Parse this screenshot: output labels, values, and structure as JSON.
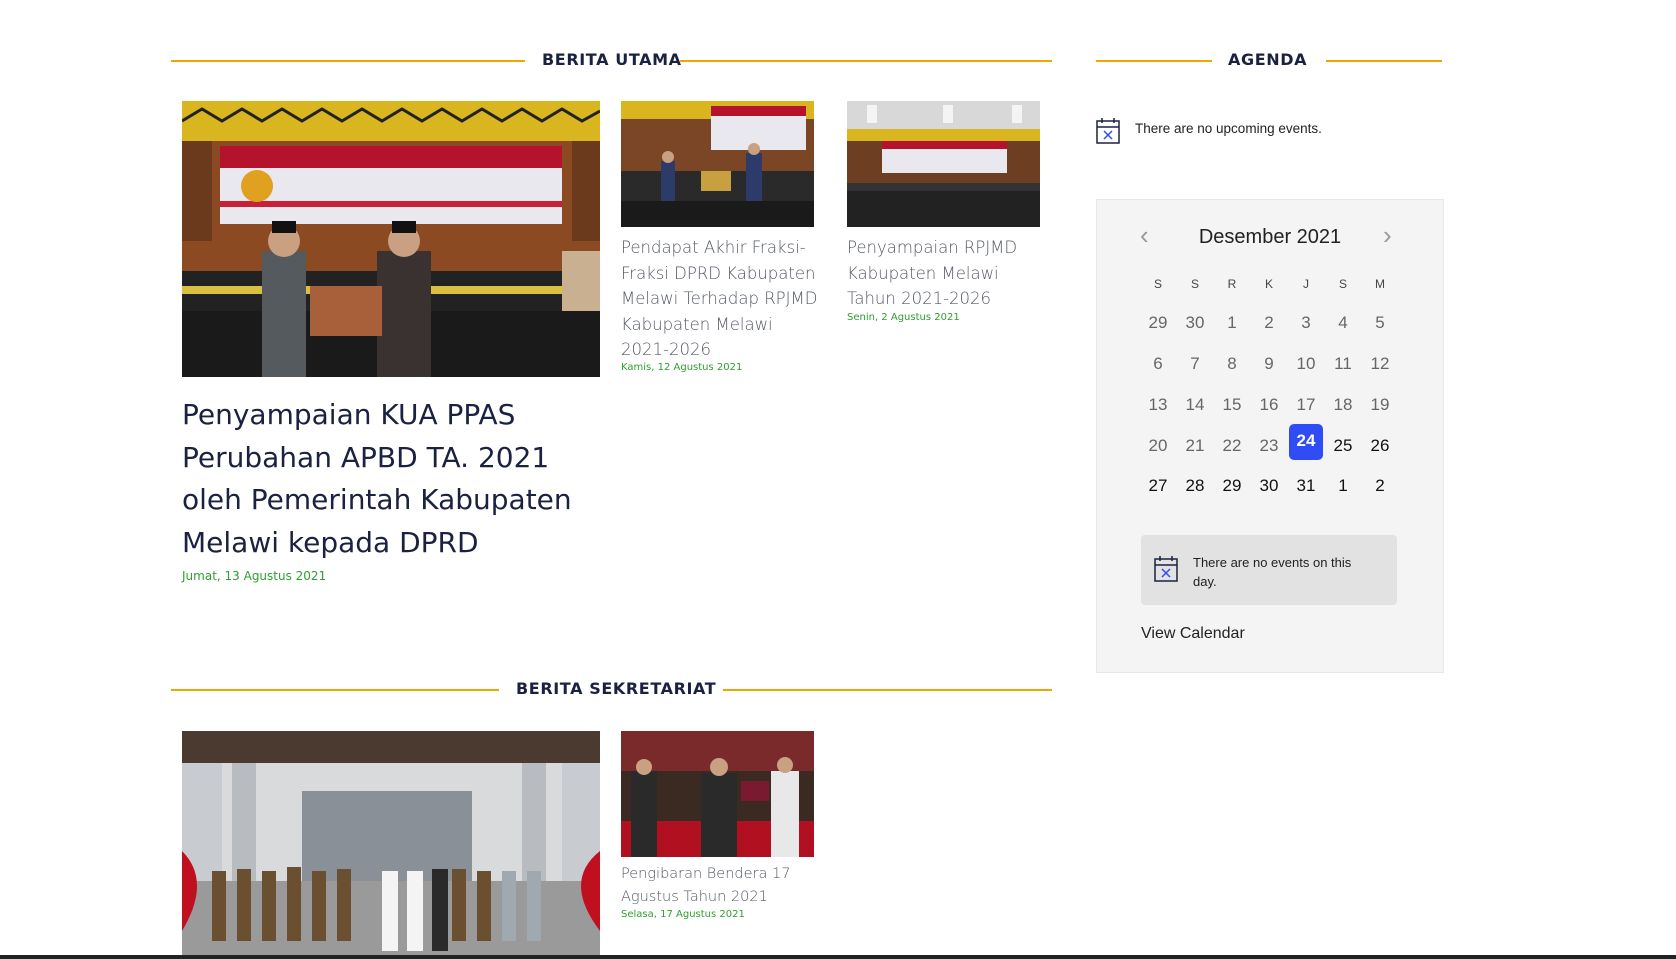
{
  "berita_utama": {
    "heading": "BERITA UTAMA",
    "featured": {
      "title": "Penyampaian KUA PPAS Perubahan APBD TA. 2021 oleh Pemerintah Kabupaten Melawi kepada DPRD",
      "date": "Jumat, 13 Agustus 2021"
    },
    "items": [
      {
        "title": "Pendapat Akhir Fraksi-Fraksi DPRD Kabupaten Melawi Terhadap RPJMD Kabupaten Melawi 2021-2026",
        "date": "Kamis, 12 Agustus 2021"
      },
      {
        "title": "Penyampaian RPJMD Kabupaten Melawi Tahun 2021-2026",
        "date": "Senin, 2 Agustus 2021"
      }
    ]
  },
  "berita_sekretariat": {
    "heading": "BERITA SEKRETARIAT",
    "items": [
      {
        "title": "Pengibaran Bendera 17 Agustus Tahun 2021",
        "date": "Selasa, 17 Agustus 2021"
      }
    ]
  },
  "agenda": {
    "heading": "AGENDA",
    "no_upcoming": "There are no upcoming events.",
    "icons": {
      "calendar": "calendar-x-icon",
      "prev": "chevron-left-icon",
      "next": "chevron-right-icon"
    },
    "calendar": {
      "month_label": "Desember 2021",
      "weekdays": [
        "S",
        "S",
        "R",
        "K",
        "J",
        "S",
        "M"
      ],
      "weeks": [
        [
          "29",
          "30",
          "1",
          "2",
          "3",
          "4",
          "5"
        ],
        [
          "6",
          "7",
          "8",
          "9",
          "10",
          "11",
          "12"
        ],
        [
          "13",
          "14",
          "15",
          "16",
          "17",
          "18",
          "19"
        ],
        [
          "20",
          "21",
          "22",
          "23",
          "24",
          "25",
          "26"
        ],
        [
          "27",
          "28",
          "29",
          "30",
          "31",
          "1",
          "2"
        ]
      ],
      "selected_day": "24",
      "accent_color": "#2f4cf5"
    },
    "no_events_day": "There are no events on this day.",
    "view_calendar": "View Calendar"
  },
  "colors": {
    "heading_line": "#f0a500",
    "date_green": "#2e9e2e",
    "title_navy": "#1b2140"
  }
}
